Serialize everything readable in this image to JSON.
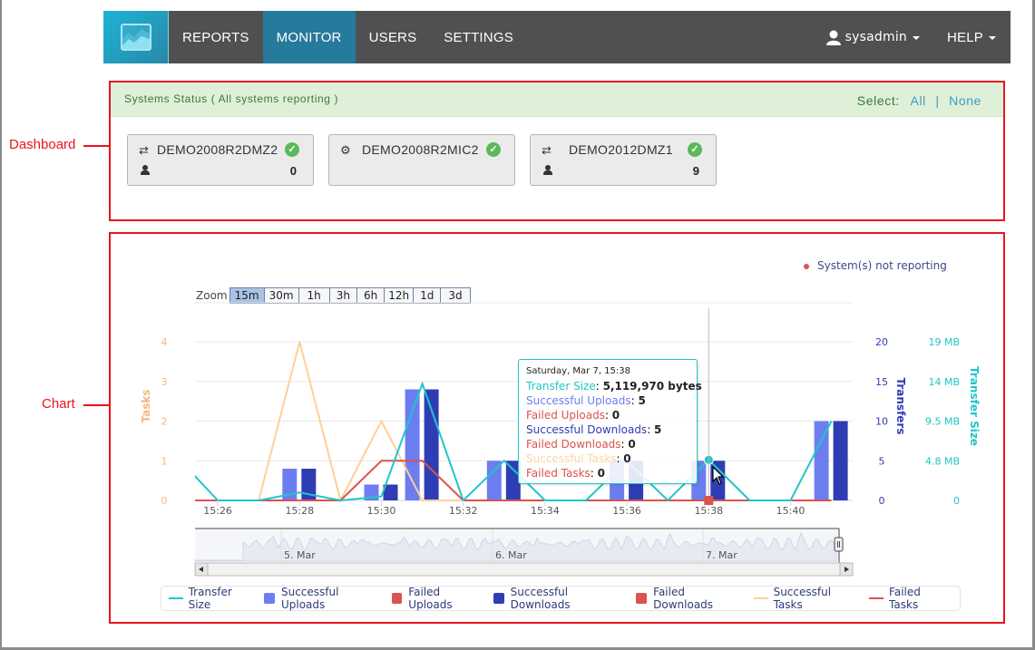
{
  "nav": {
    "logo": "app-logo",
    "items": [
      {
        "label": "REPORTS",
        "active": false
      },
      {
        "label": "MONITOR",
        "active": true
      },
      {
        "label": "USERS",
        "active": false
      },
      {
        "label": "SETTINGS",
        "active": false
      }
    ],
    "user": "sysadmin",
    "help": "HELP"
  },
  "annotations": {
    "dashboard": "Dashboard",
    "chart": "Chart"
  },
  "status": {
    "title": "Systems Status ( All systems reporting )",
    "select_label": "Select:",
    "select_all": "All",
    "select_sep": "|",
    "select_none": "None",
    "systems": [
      {
        "name": "DEMO2008R2DMZ2",
        "type_icon": "transfer-arrows-icon",
        "status": "ok",
        "users": "0"
      },
      {
        "name": "DEMO2008R2MIC2",
        "type_icon": "gears-icon",
        "status": "ok",
        "users": ""
      },
      {
        "name": "DEMO2012DMZ1",
        "type_icon": "transfer-arrows-icon",
        "status": "ok",
        "users": "9"
      }
    ]
  },
  "chart_meta": {
    "not_reporting": "System(s) not reporting",
    "zoom_label": "Zoom",
    "zoom_options": [
      "15m",
      "30m",
      "1h",
      "3h",
      "6h",
      "12h",
      "1d",
      "3d"
    ],
    "zoom_active": "15m",
    "navigator_labels": [
      "5. Mar",
      "6. Mar",
      "7. Mar"
    ]
  },
  "tooltip": {
    "date": "Saturday, Mar 7, 15:38",
    "rows": [
      {
        "label": "Transfer Size",
        "value": "5,119,970 bytes",
        "color": "#20c5c9"
      },
      {
        "label": "Successful Uploads",
        "value": "5",
        "color": "#6c7eef"
      },
      {
        "label": "Failed Uploads",
        "value": "0",
        "color": "#d9534f"
      },
      {
        "label": "Successful Downloads",
        "value": "5",
        "color": "#2f3db5"
      },
      {
        "label": "Failed Downloads",
        "value": "0",
        "color": "#d9534f"
      },
      {
        "label": "Successful Tasks",
        "value": "0",
        "color": "#fdd5a5"
      },
      {
        "label": "Failed Tasks",
        "value": "0",
        "color": "#d9534f"
      }
    ]
  },
  "colors": {
    "transfer_size": "#20c5c9",
    "successful_uploads": "#6c7eef",
    "failed_uploads": "#d9534f",
    "successful_downloads": "#2f3db5",
    "failed_downloads": "#d9534f",
    "successful_tasks": "#fdcf9a",
    "failed_tasks": "#d9534f",
    "nav_active": "#267a9b",
    "nav_bg": "#505052"
  },
  "chart_data": {
    "type": "bar",
    "x": [
      "15:25",
      "15:26",
      "15:27",
      "15:28",
      "15:29",
      "15:30",
      "15:31",
      "15:32",
      "15:33",
      "15:34",
      "15:35",
      "15:36",
      "15:37",
      "15:38",
      "15:39",
      "15:40",
      "15:41"
    ],
    "x_ticks": [
      "15:26",
      "15:28",
      "15:30",
      "15:32",
      "15:34",
      "15:36",
      "15:38",
      "15:40"
    ],
    "series": [
      {
        "name": "Transfer Size",
        "kind": "line",
        "axis": "size",
        "unit": "bytes",
        "values": [
          5500000,
          0,
          0,
          1000000,
          0,
          500000,
          14700000,
          0,
          5000000,
          0,
          0,
          5000000,
          0,
          5119970,
          0,
          0,
          10000000
        ]
      },
      {
        "name": "Successful Uploads",
        "kind": "bar",
        "axis": "transfers",
        "values": [
          0,
          0,
          0,
          4,
          0,
          2,
          14,
          0,
          5,
          0,
          0,
          5,
          0,
          5,
          0,
          0,
          10
        ]
      },
      {
        "name": "Failed Uploads",
        "kind": "bar",
        "axis": "transfers",
        "values": [
          0,
          0,
          0,
          0,
          0,
          0,
          0,
          0,
          0,
          0,
          0,
          0,
          0,
          0,
          0,
          0,
          0
        ]
      },
      {
        "name": "Successful Downloads",
        "kind": "bar",
        "axis": "transfers",
        "values": [
          0,
          0,
          0,
          4,
          0,
          2,
          14,
          0,
          5,
          0,
          0,
          5,
          0,
          5,
          0,
          0,
          10
        ]
      },
      {
        "name": "Failed Downloads",
        "kind": "bar",
        "axis": "transfers",
        "values": [
          0,
          0,
          0,
          0,
          0,
          0,
          0,
          0,
          0,
          0,
          0,
          0,
          0,
          0,
          0,
          0,
          0
        ]
      },
      {
        "name": "Successful Tasks",
        "kind": "line",
        "axis": "tasks",
        "values": [
          null,
          null,
          0,
          4,
          0,
          2,
          0,
          0,
          0,
          0,
          0,
          0,
          0,
          0,
          0,
          0,
          0
        ]
      },
      {
        "name": "Failed Tasks",
        "kind": "line",
        "axis": "tasks",
        "values": [
          0,
          0,
          0,
          0,
          0,
          1,
          1,
          0,
          0,
          0,
          0,
          0,
          0,
          0,
          0,
          0,
          0
        ]
      }
    ],
    "axes": {
      "tasks": {
        "title": "Tasks",
        "ticks": [
          "0",
          "1",
          "2",
          "3",
          "4"
        ],
        "range": [
          0,
          4
        ]
      },
      "transfers": {
        "title": "Transfers",
        "ticks": [
          "0",
          "5",
          "10",
          "15",
          "20"
        ],
        "range": [
          0,
          20
        ]
      },
      "size": {
        "title": "Transfer Size",
        "ticks": [
          "0",
          "4.8 MB",
          "9.5 MB",
          "14 MB",
          "19 MB"
        ],
        "range": [
          0,
          20000000
        ]
      }
    },
    "highlight": {
      "x": "15:38",
      "series": "Transfer Size"
    },
    "legend": [
      "Transfer Size",
      "Successful Uploads",
      "Failed Uploads",
      "Successful Downloads",
      "Failed Downloads",
      "Successful Tasks",
      "Failed Tasks"
    ],
    "legend_position": "bottom",
    "grid": true
  }
}
